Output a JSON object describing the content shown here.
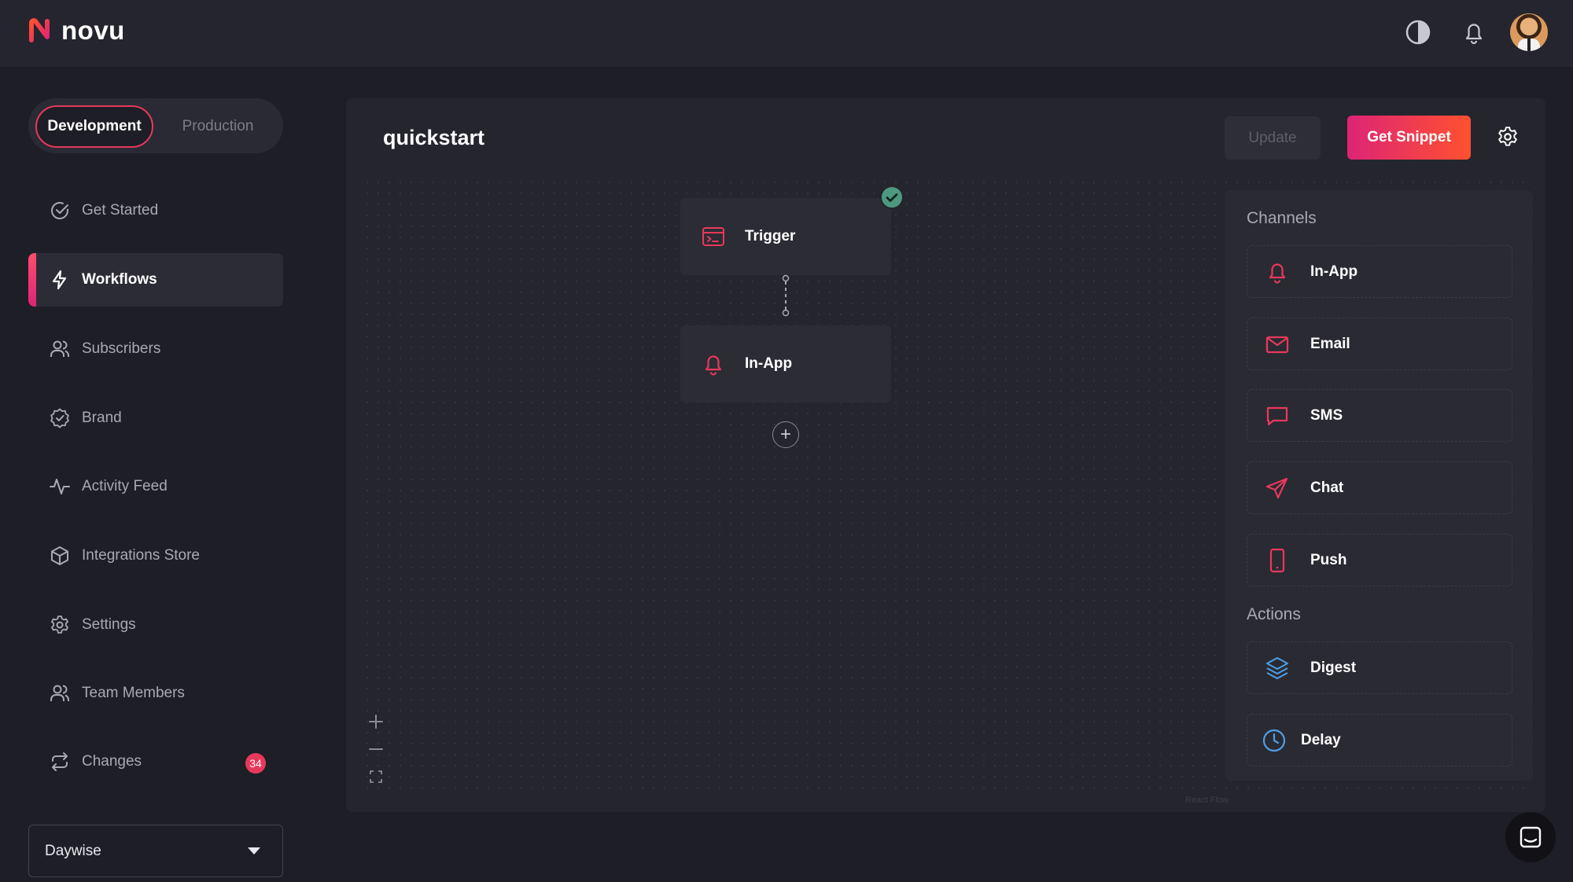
{
  "app": {
    "brand_name": "novu"
  },
  "environment": {
    "development_label": "Development",
    "production_label": "Production"
  },
  "sidebar": {
    "items": [
      {
        "label": "Get Started"
      },
      {
        "label": "Workflows"
      },
      {
        "label": "Subscribers"
      },
      {
        "label": "Brand"
      },
      {
        "label": "Activity Feed"
      },
      {
        "label": "Integrations Store"
      },
      {
        "label": "Settings"
      },
      {
        "label": "Team Members"
      },
      {
        "label": "Changes",
        "badge": "34"
      }
    ],
    "organization": "Daywise"
  },
  "workflow": {
    "title": "quickstart",
    "update_label": "Update",
    "snippet_label": "Get Snippet",
    "nodes": [
      {
        "label": "Trigger"
      },
      {
        "label": "In-App"
      }
    ],
    "add_step_symbol": "+"
  },
  "channels": {
    "title": "Channels",
    "items": [
      {
        "label": "In-App",
        "icon": "bell-icon"
      },
      {
        "label": "Email",
        "icon": "mail-icon"
      },
      {
        "label": "SMS",
        "icon": "message-icon"
      },
      {
        "label": "Chat",
        "icon": "send-icon"
      },
      {
        "label": "Push",
        "icon": "mobile-icon"
      }
    ]
  },
  "actions": {
    "title": "Actions",
    "items": [
      {
        "label": "Digest",
        "icon": "layers-icon"
      },
      {
        "label": "Delay",
        "icon": "clock-icon"
      }
    ]
  },
  "canvas": {
    "watermark": "React Flow"
  },
  "colors": {
    "accent": "#e8385c",
    "accent_gradient_start": "#dd2476",
    "accent_gradient_end": "#ff512f",
    "success": "#4d9980",
    "action_blue": "#4c9fe8"
  }
}
